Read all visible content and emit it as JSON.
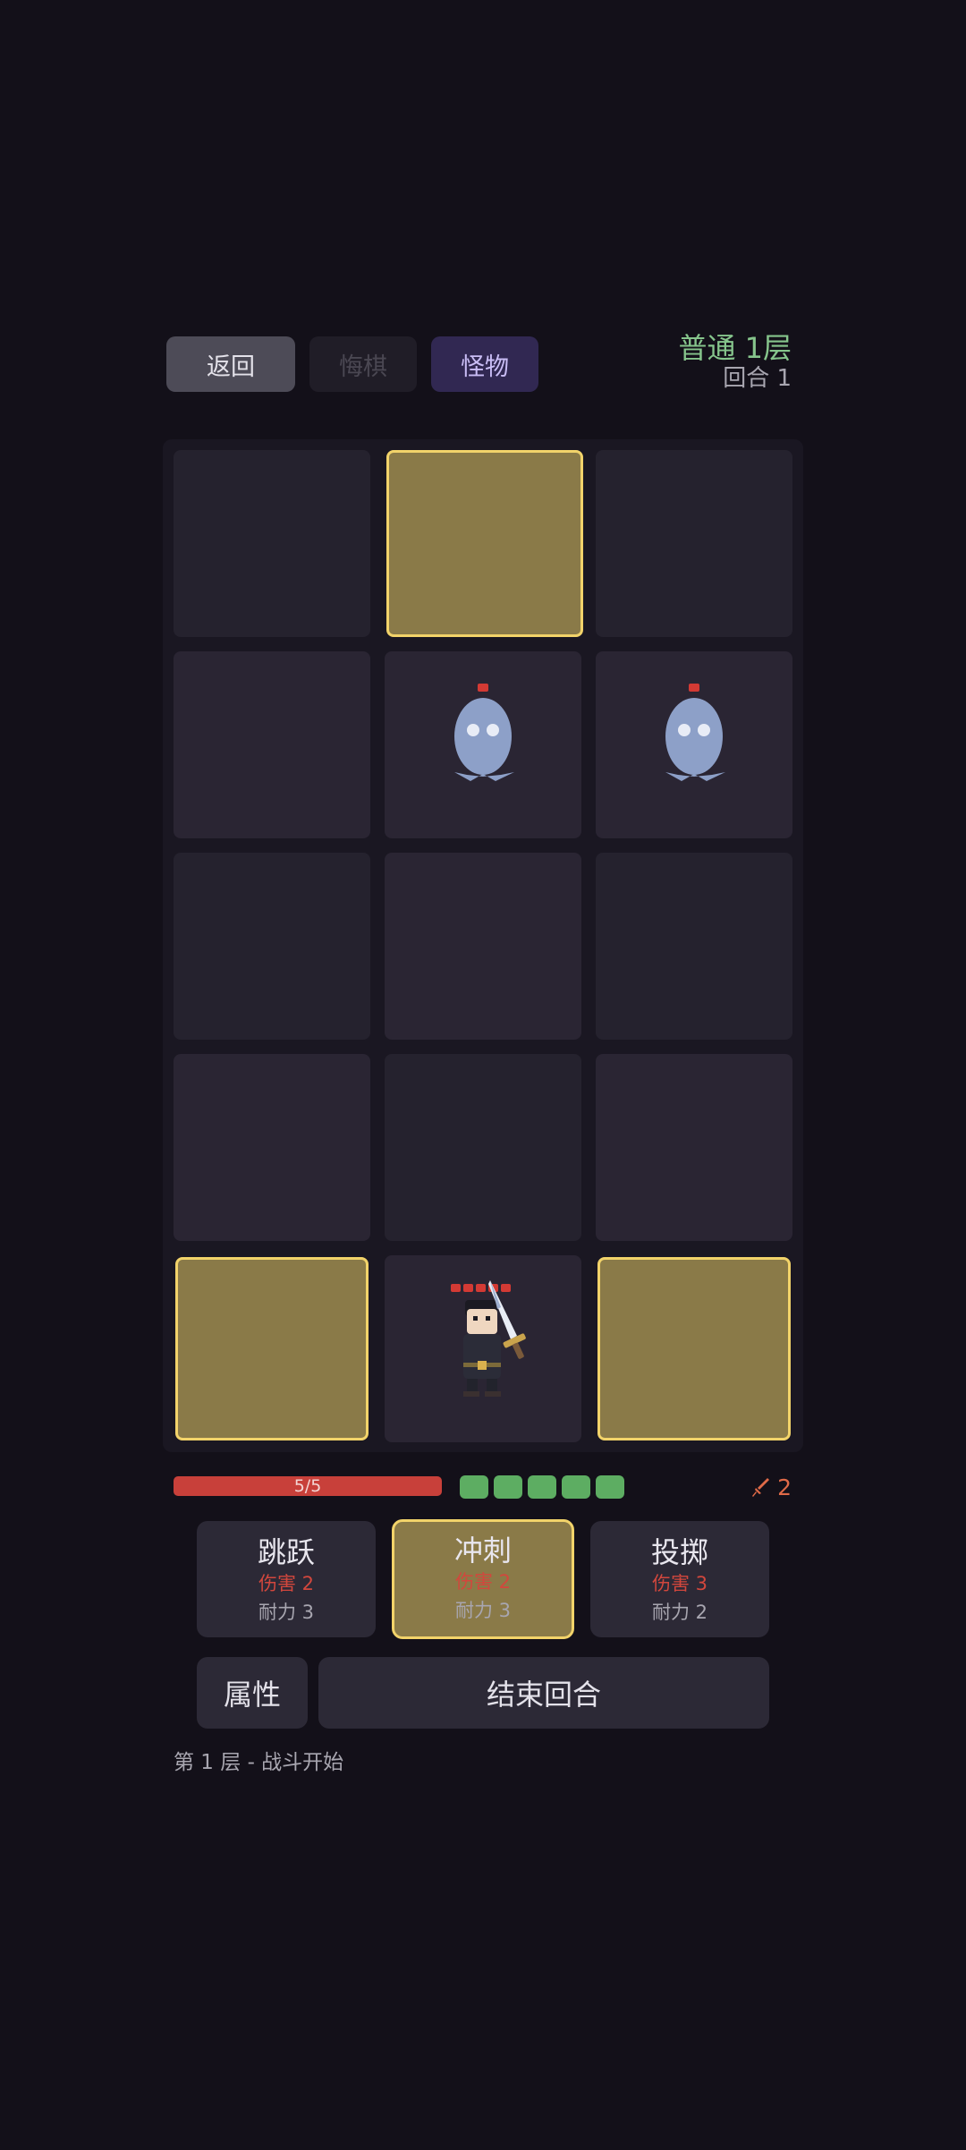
{
  "header": {
    "back_label": "返回",
    "undo_label": "悔棋",
    "monster_label": "怪物",
    "floor": "普通 1层",
    "turn": "回合 1"
  },
  "board": {
    "rows": 5,
    "cols": 3,
    "highlighted_cells": [
      [
        0,
        1
      ],
      [
        4,
        0
      ],
      [
        4,
        2
      ]
    ],
    "monsters": [
      {
        "type": "ghost",
        "row": 1,
        "col": 1,
        "hp": 1
      },
      {
        "type": "ghost",
        "row": 1,
        "col": 2,
        "hp": 1
      }
    ],
    "player": {
      "row": 4,
      "col": 1,
      "hp_pips": 5
    }
  },
  "status": {
    "hp_text": "5/5",
    "hp_fraction": 1.0,
    "stamina": 5,
    "attack": "2",
    "attack_icon": "sword-icon"
  },
  "cards": [
    {
      "name": "跳跃",
      "damage": "伤害 2",
      "stamina": "耐力 3",
      "selected": false
    },
    {
      "name": "冲刺",
      "damage": "伤害 2",
      "stamina": "耐力 3",
      "selected": true
    },
    {
      "name": "投掷",
      "damage": "伤害 3",
      "stamina": "耐力 2",
      "selected": false
    }
  ],
  "actions": {
    "attributes_label": "属性",
    "end_turn_label": "结束回合"
  },
  "log": "第 1 层 - 战斗开始",
  "colors": {
    "background": "#131019",
    "highlight": "#f2d36a",
    "hp": "#c8403a",
    "stamina": "#5dad62",
    "floor_text": "#86c58c"
  }
}
